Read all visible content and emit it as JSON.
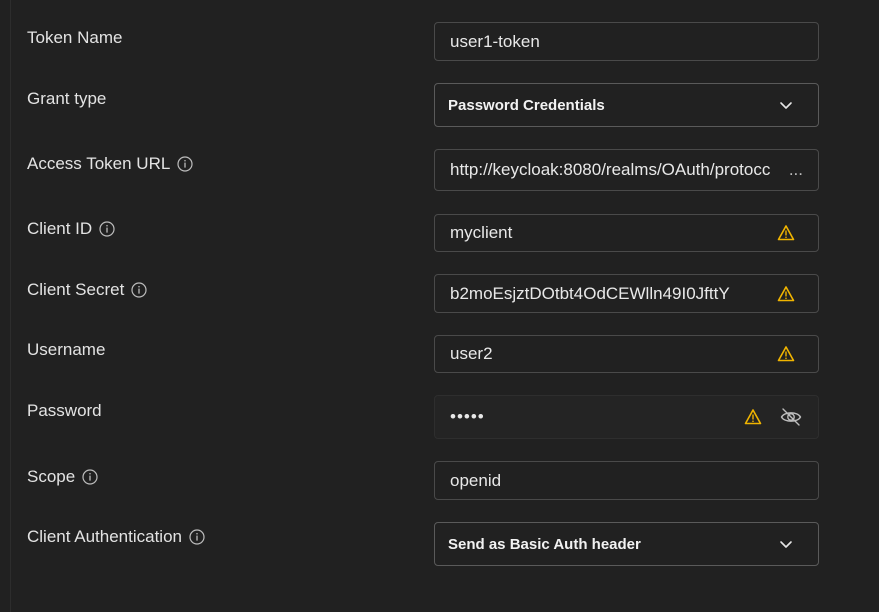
{
  "fields": {
    "token_name": {
      "label": "Token Name",
      "value": "user1-token"
    },
    "grant_type": {
      "label": "Grant type",
      "value": "Password Credentials"
    },
    "access_token_url": {
      "label": "Access Token URL",
      "value": "http://keycloak:8080/realms/OAuth/protocc",
      "overflow_marker": "..."
    },
    "client_id": {
      "label": "Client ID",
      "value": "myclient"
    },
    "client_secret": {
      "label": "Client Secret",
      "value": "b2moEsjztDOtbt4OdCEWlln49I0JfttY"
    },
    "username": {
      "label": "Username",
      "value": "user2"
    },
    "password": {
      "label": "Password",
      "value": "•••••"
    },
    "scope": {
      "label": "Scope",
      "value": "openid"
    },
    "client_authentication": {
      "label": "Client Authentication",
      "value": "Send as Basic Auth header"
    }
  },
  "icons": {
    "info": "info-icon",
    "warning": "warning-icon",
    "chevron": "chevron-down-icon",
    "visibility": "eye-off-icon"
  },
  "colors": {
    "background": "#212121",
    "border": "#4a4a4a",
    "warning": "#f0b400",
    "text": "#e6e6e6"
  }
}
